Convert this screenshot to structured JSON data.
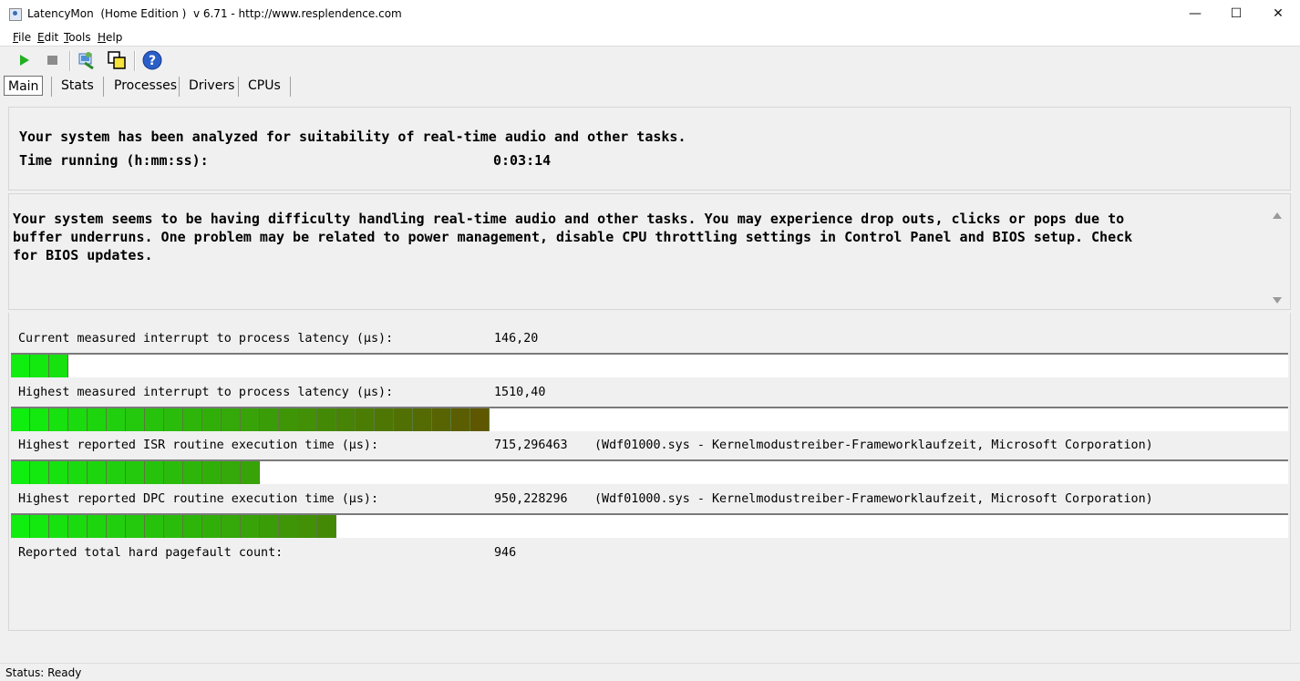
{
  "window": {
    "title": "LatencyMon  (Home Edition )  v 6.71 - http://www.resplendence.com",
    "minimize_glyph": "—",
    "maximize_glyph": "☐",
    "close_glyph": "✕"
  },
  "menu": [
    {
      "accel": "F",
      "rest": "ile"
    },
    {
      "accel": "E",
      "rest": "dit"
    },
    {
      "accel": "T",
      "rest": "ools"
    },
    {
      "accel": "H",
      "rest": "elp"
    }
  ],
  "toolbar": {
    "icons": [
      "play-icon",
      "stop-icon",
      "system-info-icon",
      "windows-icon",
      "help-icon"
    ],
    "colors": {
      "play": "#22b022",
      "stop": "#8c8c8c",
      "help": "#2a5fc8"
    }
  },
  "tabs": [
    "Main",
    "Stats",
    "Processes",
    "Drivers",
    "CPUs"
  ],
  "summary": {
    "headline": "Your system has been analyzed for suitability of real-time audio and other tasks.",
    "time_label": "Time running (h:mm:ss):",
    "time_value": "0:03:14"
  },
  "message": {
    "line1": "Your system seems to be having difficulty handling real-time audio and other tasks. You may experience drop outs, clicks or pops due to",
    "line2": "buffer underruns. One problem may be related to power management, disable CPU throttling settings in Control Panel and BIOS setup. Check",
    "line3": "for BIOS updates."
  },
  "metrics": [
    {
      "label": "Current measured interrupt to process latency (µs):",
      "value": "146,20",
      "detail": "",
      "bar_segments": 3
    },
    {
      "label": "Highest measured interrupt to process latency (µs):",
      "value": "1510,40",
      "detail": "",
      "bar_segments": 25
    },
    {
      "label": "Highest reported ISR routine execution time (µs):",
      "value": "715,296463",
      "detail": "(Wdf01000.sys - Kernelmodustreiber-Frameworklaufzeit, Microsoft Corporation)",
      "bar_segments": 13
    },
    {
      "label": "Highest reported DPC routine execution time (µs):",
      "value": "950,228296",
      "detail": "(Wdf01000.sys - Kernelmodustreiber-Frameworklaufzeit, Microsoft Corporation)",
      "bar_segments": 17
    }
  ],
  "pagefault": {
    "label": "Reported total hard pagefault count:",
    "value": "946"
  },
  "bar_colors": {
    "start": "#10ee10",
    "end": "#5e5700"
  },
  "status": "Status: Ready"
}
